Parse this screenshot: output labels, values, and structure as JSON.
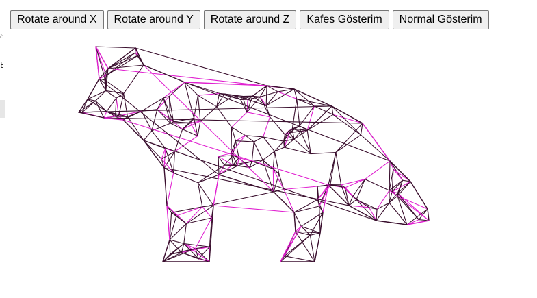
{
  "toolbar": {
    "rotate_x_label": "Rotate around X",
    "rotate_y_label": "Rotate around Y",
    "rotate_z_label": "Rotate around Z",
    "wireframe_label": "Kafes Gösterim",
    "normal_label": "Normal Gösterim"
  },
  "left_edge": {
    "glyph_a": "a",
    "glyph_b": "E"
  },
  "viewport": {
    "wire_color_primary": "#3a0f2e",
    "wire_color_accent": "#e020d0",
    "background": "#ffffff"
  }
}
